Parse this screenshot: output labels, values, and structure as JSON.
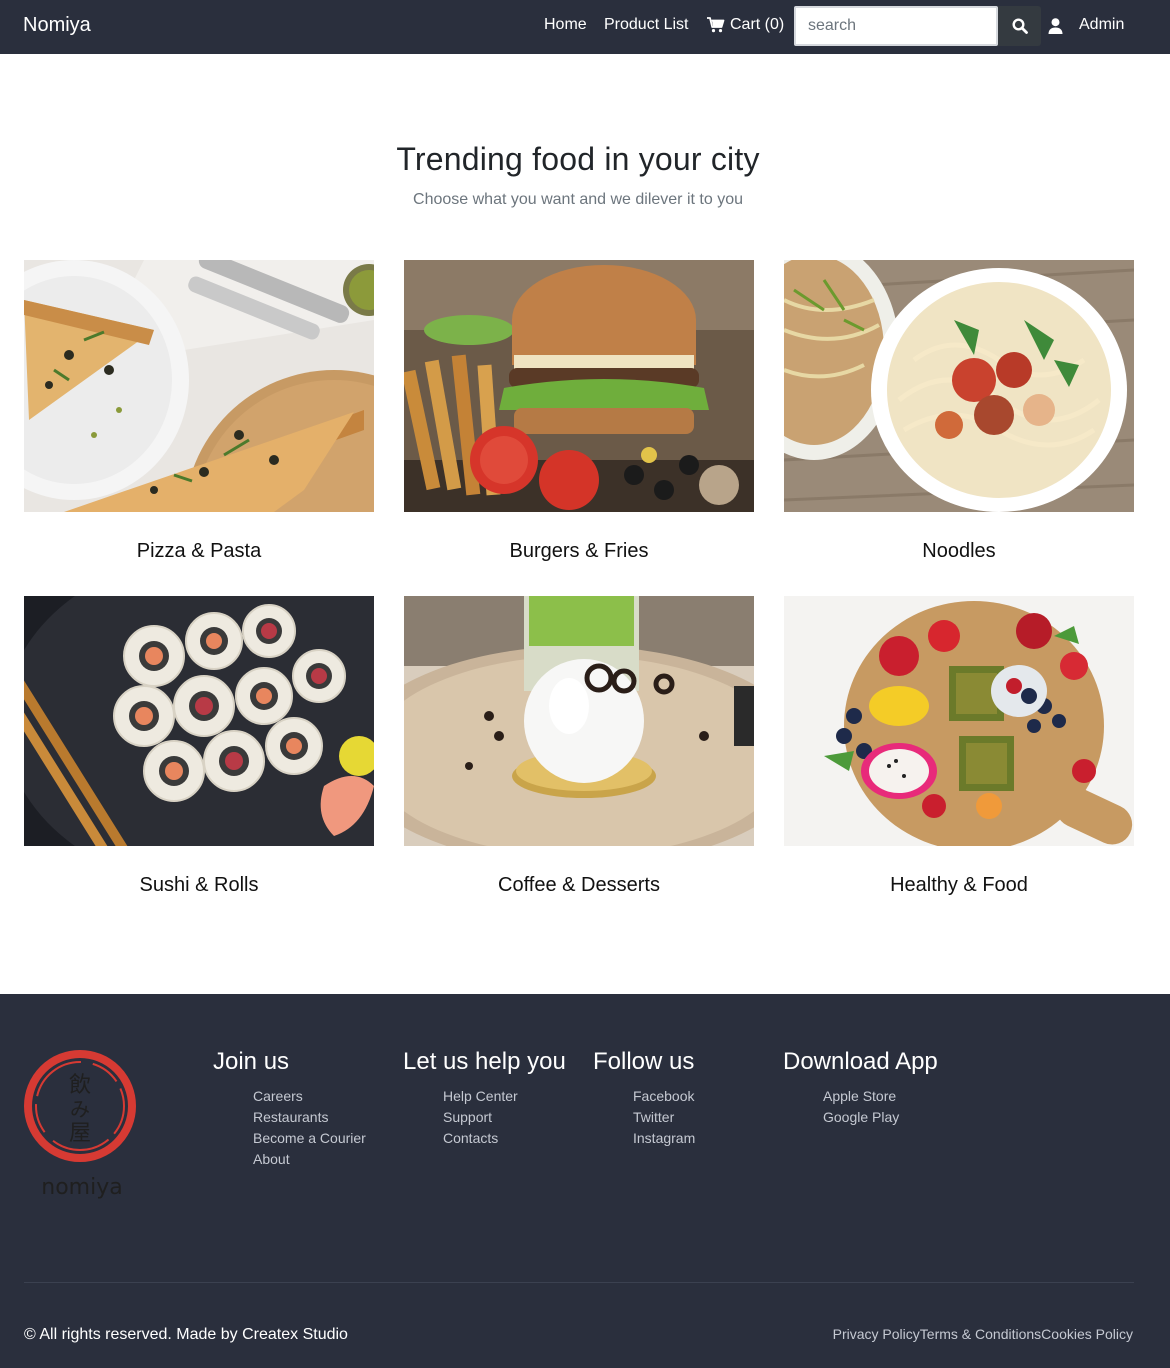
{
  "nav": {
    "brand": "Nomiya",
    "home": "Home",
    "product_list": "Product List",
    "cart": "Cart (0)",
    "search_placeholder": "search",
    "admin": "Admin"
  },
  "hero": {
    "title": "Trending food in your city",
    "subtitle": "Choose what you want and we dilever it to you"
  },
  "categories": [
    {
      "label": "Pizza & Pasta",
      "image": "pizza-photo"
    },
    {
      "label": "Burgers & Fries",
      "image": "burger-photo"
    },
    {
      "label": "Noodles",
      "image": "noodles-photo"
    },
    {
      "label": "Sushi & Rolls",
      "image": "sushi-photo"
    },
    {
      "label": "Coffee & Desserts",
      "image": "dessert-photo"
    },
    {
      "label": "Healthy & Food",
      "image": "fruit-platter-photo"
    }
  ],
  "footer": {
    "logo_text": "nomiya",
    "logo_kanji": "飲み屋",
    "columns": [
      {
        "heading": "Join us",
        "links": [
          "Careers",
          "Restaurants",
          "Become a Courier",
          "About"
        ]
      },
      {
        "heading": "Let us help you",
        "links": [
          "Help Center",
          "Support",
          "Contacts"
        ]
      },
      {
        "heading": "Follow us",
        "links": [
          "Facebook",
          "Twitter",
          "Instagram"
        ]
      },
      {
        "heading": "Download App",
        "links": [
          "Apple Store",
          "Google Play"
        ]
      }
    ],
    "copyright": "© All rights reserved. Made by Createx Studio",
    "privacy": "Privacy Policy",
    "terms": "Terms & Conditions",
    "cookies": "Cookies Policy"
  },
  "colors": {
    "navbar_bg": "#2a2f3d",
    "footer_bg": "#2a2f3d",
    "logo_red": "#d63a33"
  }
}
